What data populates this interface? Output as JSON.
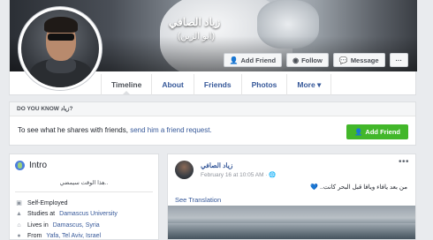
{
  "profile": {
    "name": "زياد الصافي",
    "alt_name": "(ابو الزين)",
    "buttons": {
      "add_friend": "Add Friend",
      "follow": "Follow",
      "message": "Message",
      "more": "···"
    },
    "tabs": [
      "Timeline",
      "About",
      "Friends",
      "Photos",
      "More ▾"
    ]
  },
  "do_you_know": {
    "header": "DO YOU KNOW زياد?",
    "text_before": "To see what he shares with friends, ",
    "link": "send him a friend request.",
    "button": "Add Friend"
  },
  "intro": {
    "title": "Intro",
    "bio": "هذا الوقت سيمضي..",
    "items": [
      {
        "icon": "briefcase-icon",
        "text": "Self-Employed",
        "link": ""
      },
      {
        "icon": "school-icon",
        "text": "Studies at ",
        "link": "Damascus University"
      },
      {
        "icon": "home-icon",
        "text": "Lives in ",
        "link": "Damascus, Syria"
      },
      {
        "icon": "location-icon",
        "text": "From ",
        "link": "Yafa, Tel Aviv, Israel"
      }
    ]
  },
  "post": {
    "author": "زياد الصافي",
    "date": "February 16 at 10:05 AM",
    "privacy_glyph": "·",
    "text": "من بعد يافاء ويافا قبل البحر كانت.. 💙",
    "see_translation": "See Translation",
    "more": "•••"
  },
  "colors": {
    "link": "#365899",
    "green": "#42b72a",
    "background": "#e9ebee"
  }
}
